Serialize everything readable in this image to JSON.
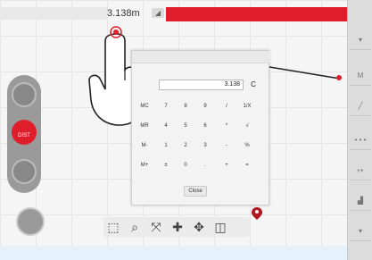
{
  "top_bar": {
    "distance": "3.138m"
  },
  "calculator": {
    "display": "3.138",
    "clear_key": "C",
    "rows": [
      [
        "MC",
        "7",
        "8",
        "9",
        "/",
        "1/X"
      ],
      [
        "MR",
        "4",
        "5",
        "6",
        "*",
        "√"
      ],
      [
        "M-",
        "1",
        "2",
        "3",
        "-",
        "%"
      ],
      [
        "M+",
        "±",
        "0",
        ".",
        "+",
        "="
      ]
    ],
    "close_label": "Close"
  },
  "left_toolbar": {
    "dist_label": "DIST"
  },
  "right_toolbar": {
    "m_label": "M"
  },
  "colors": {
    "accent_red": "#e01e2b",
    "toolbar_gray": "#9a9a9a"
  },
  "tools": [
    "select-region-icon",
    "zoom-icon",
    "fit-icon",
    "pan-icon",
    "move-icon",
    "3d-view-icon"
  ]
}
